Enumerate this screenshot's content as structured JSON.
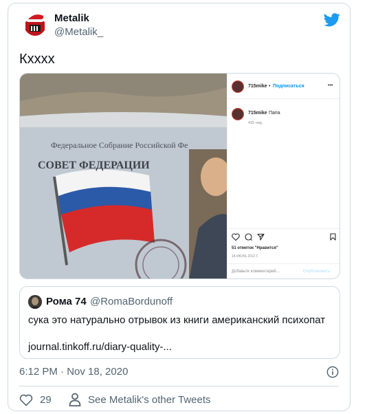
{
  "author": {
    "name": "Metalik",
    "handle": "@Metalik_"
  },
  "tweet": {
    "text": "Кхххх"
  },
  "media": {
    "photo": {
      "line1": "Федеральное Собрание Российской Фе",
      "line2": "СОВЕТ ФЕДЕРАЦИИ"
    },
    "instagram": {
      "user": "715mike",
      "sep": "•",
      "follow": "Подписаться",
      "menu": "•••",
      "comment_user": "715mike",
      "comment_text": "Папа",
      "comment_age": "435 нед.",
      "likes": "51 отметок \"Нравится\"",
      "date": "18 ИЮЛЬ 2012 Г.",
      "add_comment": "Добавьте комментарий...",
      "publish": "Опубликовать"
    }
  },
  "quote": {
    "name": "Рома 74",
    "handle": "@RomaBordunoff",
    "text": "сука это натурально отрывок из книги американский психопат",
    "link": "journal.tinkoff.ru/diary-quality-..."
  },
  "timestamp": "6:12 PM · Nov 18, 2020",
  "footer": {
    "likes": "29",
    "others": "See Metalik's other Tweets"
  },
  "colors": {
    "twitter_blue": "#1d9bf0",
    "muted": "#536471",
    "border": "#cfd9de"
  }
}
